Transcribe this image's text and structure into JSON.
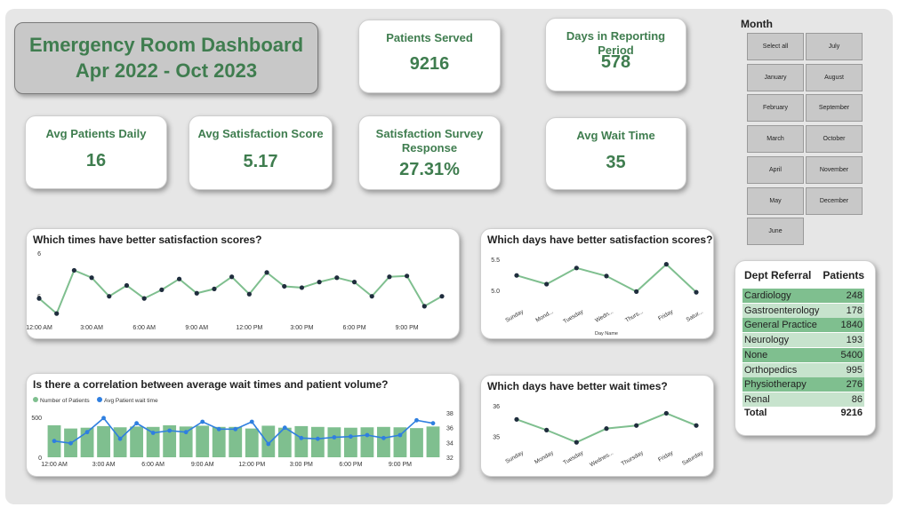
{
  "dashboard": {
    "title_line1": "Emergency Room Dashboard",
    "title_line2": "Apr 2022 - Oct 2023"
  },
  "kpis": {
    "patients_served": {
      "label": "Patients Served",
      "value": "9216"
    },
    "days_in_period": {
      "label": "Days in Reporting Period",
      "value": "578"
    },
    "avg_patients_daily": {
      "label": "Avg Patients Daily",
      "value": "16"
    },
    "avg_satisfaction": {
      "label": "Avg Satisfaction Score",
      "value": "5.17"
    },
    "survey_response": {
      "label": "Satisfaction Survey Response",
      "value": "27.31%"
    },
    "avg_wait": {
      "label": "Avg Wait Time",
      "value": "35"
    }
  },
  "month_slicer": {
    "title": "Month",
    "buttons": [
      "Select all",
      "July",
      "January",
      "August",
      "February",
      "September",
      "March",
      "October",
      "April",
      "November",
      "May",
      "December",
      "June"
    ]
  },
  "dept_referral": {
    "header_dept": "Dept Referral",
    "header_patients": "Patients",
    "rows": [
      {
        "name": "Cardiology",
        "value": "248",
        "shade": "#7fbf8f"
      },
      {
        "name": "Gastroenterology",
        "value": "178",
        "shade": "#c7e3cd"
      },
      {
        "name": "General Practice",
        "value": "1840",
        "shade": "#7fbf8f"
      },
      {
        "name": "Neurology",
        "value": "193",
        "shade": "#c7e3cd"
      },
      {
        "name": "None",
        "value": "5400",
        "shade": "#7fbf8f"
      },
      {
        "name": "Orthopedics",
        "value": "995",
        "shade": "#c7e3cd"
      },
      {
        "name": "Physiotherapy",
        "value": "276",
        "shade": "#7fbf8f"
      },
      {
        "name": "Renal",
        "value": "86",
        "shade": "#c7e3cd"
      }
    ],
    "total_label": "Total",
    "total_value": "9216"
  },
  "colors": {
    "accent_green": "#3f7d4f",
    "line_green": "#7fbf8f",
    "point_dark": "#1f2d3d",
    "line_blue": "#2f7fe0"
  },
  "chart_data": [
    {
      "id": "hour_satisfaction",
      "type": "line",
      "title": "Which times have better satisfaction scores?",
      "x": [
        0,
        1,
        2,
        3,
        4,
        5,
        6,
        7,
        8,
        9,
        10,
        11,
        12,
        13,
        14,
        15,
        16,
        17,
        18,
        19,
        20,
        21,
        22,
        23
      ],
      "tick_labels": [
        "12:00 AM",
        "3:00 AM",
        "6:00 AM",
        "9:00 AM",
        "12:00 PM",
        "3:00 PM",
        "6:00 PM",
        "9:00 PM"
      ],
      "tick_positions": [
        0,
        3,
        6,
        9,
        12,
        15,
        18,
        21
      ],
      "values": [
        4.95,
        4.6,
        5.6,
        5.43,
        5.0,
        5.25,
        4.95,
        5.15,
        5.4,
        5.07,
        5.17,
        5.45,
        5.05,
        5.55,
        5.23,
        5.2,
        5.33,
        5.43,
        5.33,
        5.0,
        5.45,
        5.47,
        4.77,
        5.0
      ],
      "ylim": [
        4.5,
        6
      ],
      "yticks": [
        "6",
        "5"
      ]
    },
    {
      "id": "day_satisfaction",
      "type": "line",
      "title": "Which days have better satisfaction scores?",
      "categories": [
        "Sunday",
        "Mond...",
        "Tuesday",
        "Wedn...",
        "Thurs...",
        "Friday",
        "Satur..."
      ],
      "values": [
        5.24,
        5.1,
        5.36,
        5.23,
        4.98,
        5.42,
        4.97
      ],
      "ylim": [
        4.7,
        5.6
      ],
      "yticks": [
        "5.5",
        "5.0"
      ],
      "xlabel": "Day Name"
    },
    {
      "id": "wait_vs_volume",
      "type": "bar",
      "title": "Is there a correlation between average wait times and patient volume?",
      "legend": [
        "Number of Patients",
        "Avg Patient wait time"
      ],
      "x": [
        0,
        1,
        2,
        3,
        4,
        5,
        6,
        7,
        8,
        9,
        10,
        11,
        12,
        13,
        14,
        15,
        16,
        17,
        18,
        19,
        20,
        21,
        22,
        23
      ],
      "tick_labels": [
        "12:00 AM",
        "3:00 AM",
        "6:00 AM",
        "9:00 AM",
        "12:00 PM",
        "3:00 PM",
        "6:00 PM",
        "9:00 PM"
      ],
      "tick_positions": [
        0,
        3,
        6,
        9,
        12,
        15,
        18,
        21
      ],
      "series": [
        {
          "name": "Number of Patients",
          "values": [
            400,
            360,
            370,
            390,
            375,
            385,
            380,
            400,
            385,
            395,
            380,
            380,
            360,
            395,
            370,
            390,
            380,
            375,
            370,
            375,
            380,
            375,
            365,
            385
          ]
        },
        {
          "name": "Avg Patient wait time",
          "values": [
            34.2,
            33.9,
            35.4,
            37.3,
            34.5,
            36.6,
            35.3,
            35.6,
            35.4,
            36.8,
            35.8,
            35.8,
            36.8,
            33.8,
            36.0,
            34.6,
            34.5,
            34.7,
            34.8,
            35.0,
            34.6,
            35.0,
            37.0,
            36.6
          ]
        }
      ],
      "y_left_ticks": [
        "500",
        "0"
      ],
      "y_left_lim": [
        0,
        600
      ],
      "y_right_ticks": [
        "38",
        "36",
        "34",
        "32"
      ],
      "y_right_lim": [
        32,
        38
      ]
    },
    {
      "id": "day_wait",
      "type": "line",
      "title": "Which days have better wait times?",
      "categories": [
        "Sunday",
        "Monday",
        "Tuesday",
        "Wednes...",
        "Thursday",
        "Friday",
        "Saturday"
      ],
      "values": [
        35.55,
        35.2,
        34.8,
        35.25,
        35.35,
        35.75,
        35.35
      ],
      "ylim": [
        34.6,
        36.2
      ],
      "yticks": [
        "36",
        "35"
      ]
    }
  ]
}
